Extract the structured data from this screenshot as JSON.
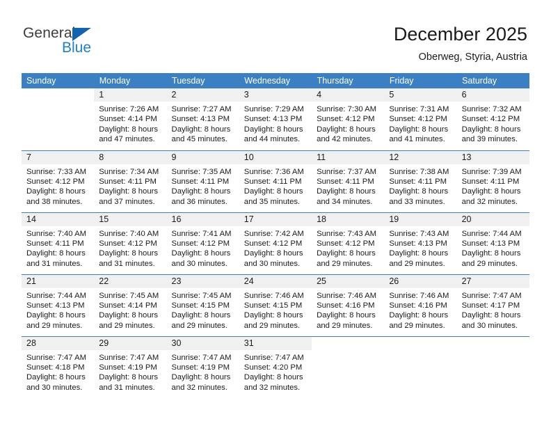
{
  "brand": {
    "name_primary": "General",
    "name_secondary": "Blue",
    "primary_color": "#3d3d3d",
    "secondary_color": "#1b7fd4",
    "triangle_color": "#1263b0"
  },
  "header": {
    "title": "December 2025",
    "subtitle": "Oberweg, Styria, Austria"
  },
  "calendar": {
    "header_bg": "#3b80c4",
    "daynum_bg": "#f0f0f0",
    "weekdays": [
      "Sunday",
      "Monday",
      "Tuesday",
      "Wednesday",
      "Thursday",
      "Friday",
      "Saturday"
    ],
    "weeks": [
      [
        {
          "day": "",
          "sunrise": "",
          "sunset": "",
          "daylight": "",
          "daylight2": ""
        },
        {
          "day": "1",
          "sunrise": "Sunrise: 7:26 AM",
          "sunset": "Sunset: 4:14 PM",
          "daylight": "Daylight: 8 hours",
          "daylight2": "and 47 minutes."
        },
        {
          "day": "2",
          "sunrise": "Sunrise: 7:27 AM",
          "sunset": "Sunset: 4:13 PM",
          "daylight": "Daylight: 8 hours",
          "daylight2": "and 45 minutes."
        },
        {
          "day": "3",
          "sunrise": "Sunrise: 7:29 AM",
          "sunset": "Sunset: 4:13 PM",
          "daylight": "Daylight: 8 hours",
          "daylight2": "and 44 minutes."
        },
        {
          "day": "4",
          "sunrise": "Sunrise: 7:30 AM",
          "sunset": "Sunset: 4:12 PM",
          "daylight": "Daylight: 8 hours",
          "daylight2": "and 42 minutes."
        },
        {
          "day": "5",
          "sunrise": "Sunrise: 7:31 AM",
          "sunset": "Sunset: 4:12 PM",
          "daylight": "Daylight: 8 hours",
          "daylight2": "and 41 minutes."
        },
        {
          "day": "6",
          "sunrise": "Sunrise: 7:32 AM",
          "sunset": "Sunset: 4:12 PM",
          "daylight": "Daylight: 8 hours",
          "daylight2": "and 39 minutes."
        }
      ],
      [
        {
          "day": "7",
          "sunrise": "Sunrise: 7:33 AM",
          "sunset": "Sunset: 4:12 PM",
          "daylight": "Daylight: 8 hours",
          "daylight2": "and 38 minutes."
        },
        {
          "day": "8",
          "sunrise": "Sunrise: 7:34 AM",
          "sunset": "Sunset: 4:11 PM",
          "daylight": "Daylight: 8 hours",
          "daylight2": "and 37 minutes."
        },
        {
          "day": "9",
          "sunrise": "Sunrise: 7:35 AM",
          "sunset": "Sunset: 4:11 PM",
          "daylight": "Daylight: 8 hours",
          "daylight2": "and 36 minutes."
        },
        {
          "day": "10",
          "sunrise": "Sunrise: 7:36 AM",
          "sunset": "Sunset: 4:11 PM",
          "daylight": "Daylight: 8 hours",
          "daylight2": "and 35 minutes."
        },
        {
          "day": "11",
          "sunrise": "Sunrise: 7:37 AM",
          "sunset": "Sunset: 4:11 PM",
          "daylight": "Daylight: 8 hours",
          "daylight2": "and 34 minutes."
        },
        {
          "day": "12",
          "sunrise": "Sunrise: 7:38 AM",
          "sunset": "Sunset: 4:11 PM",
          "daylight": "Daylight: 8 hours",
          "daylight2": "and 33 minutes."
        },
        {
          "day": "13",
          "sunrise": "Sunrise: 7:39 AM",
          "sunset": "Sunset: 4:11 PM",
          "daylight": "Daylight: 8 hours",
          "daylight2": "and 32 minutes."
        }
      ],
      [
        {
          "day": "14",
          "sunrise": "Sunrise: 7:40 AM",
          "sunset": "Sunset: 4:11 PM",
          "daylight": "Daylight: 8 hours",
          "daylight2": "and 31 minutes."
        },
        {
          "day": "15",
          "sunrise": "Sunrise: 7:40 AM",
          "sunset": "Sunset: 4:12 PM",
          "daylight": "Daylight: 8 hours",
          "daylight2": "and 31 minutes."
        },
        {
          "day": "16",
          "sunrise": "Sunrise: 7:41 AM",
          "sunset": "Sunset: 4:12 PM",
          "daylight": "Daylight: 8 hours",
          "daylight2": "and 30 minutes."
        },
        {
          "day": "17",
          "sunrise": "Sunrise: 7:42 AM",
          "sunset": "Sunset: 4:12 PM",
          "daylight": "Daylight: 8 hours",
          "daylight2": "and 30 minutes."
        },
        {
          "day": "18",
          "sunrise": "Sunrise: 7:43 AM",
          "sunset": "Sunset: 4:12 PM",
          "daylight": "Daylight: 8 hours",
          "daylight2": "and 29 minutes."
        },
        {
          "day": "19",
          "sunrise": "Sunrise: 7:43 AM",
          "sunset": "Sunset: 4:13 PM",
          "daylight": "Daylight: 8 hours",
          "daylight2": "and 29 minutes."
        },
        {
          "day": "20",
          "sunrise": "Sunrise: 7:44 AM",
          "sunset": "Sunset: 4:13 PM",
          "daylight": "Daylight: 8 hours",
          "daylight2": "and 29 minutes."
        }
      ],
      [
        {
          "day": "21",
          "sunrise": "Sunrise: 7:44 AM",
          "sunset": "Sunset: 4:13 PM",
          "daylight": "Daylight: 8 hours",
          "daylight2": "and 29 minutes."
        },
        {
          "day": "22",
          "sunrise": "Sunrise: 7:45 AM",
          "sunset": "Sunset: 4:14 PM",
          "daylight": "Daylight: 8 hours",
          "daylight2": "and 29 minutes."
        },
        {
          "day": "23",
          "sunrise": "Sunrise: 7:45 AM",
          "sunset": "Sunset: 4:15 PM",
          "daylight": "Daylight: 8 hours",
          "daylight2": "and 29 minutes."
        },
        {
          "day": "24",
          "sunrise": "Sunrise: 7:46 AM",
          "sunset": "Sunset: 4:15 PM",
          "daylight": "Daylight: 8 hours",
          "daylight2": "and 29 minutes."
        },
        {
          "day": "25",
          "sunrise": "Sunrise: 7:46 AM",
          "sunset": "Sunset: 4:16 PM",
          "daylight": "Daylight: 8 hours",
          "daylight2": "and 29 minutes."
        },
        {
          "day": "26",
          "sunrise": "Sunrise: 7:46 AM",
          "sunset": "Sunset: 4:16 PM",
          "daylight": "Daylight: 8 hours",
          "daylight2": "and 29 minutes."
        },
        {
          "day": "27",
          "sunrise": "Sunrise: 7:47 AM",
          "sunset": "Sunset: 4:17 PM",
          "daylight": "Daylight: 8 hours",
          "daylight2": "and 30 minutes."
        }
      ],
      [
        {
          "day": "28",
          "sunrise": "Sunrise: 7:47 AM",
          "sunset": "Sunset: 4:18 PM",
          "daylight": "Daylight: 8 hours",
          "daylight2": "and 30 minutes."
        },
        {
          "day": "29",
          "sunrise": "Sunrise: 7:47 AM",
          "sunset": "Sunset: 4:19 PM",
          "daylight": "Daylight: 8 hours",
          "daylight2": "and 31 minutes."
        },
        {
          "day": "30",
          "sunrise": "Sunrise: 7:47 AM",
          "sunset": "Sunset: 4:19 PM",
          "daylight": "Daylight: 8 hours",
          "daylight2": "and 32 minutes."
        },
        {
          "day": "31",
          "sunrise": "Sunrise: 7:47 AM",
          "sunset": "Sunset: 4:20 PM",
          "daylight": "Daylight: 8 hours",
          "daylight2": "and 32 minutes."
        },
        {
          "day": "",
          "sunrise": "",
          "sunset": "",
          "daylight": "",
          "daylight2": ""
        },
        {
          "day": "",
          "sunrise": "",
          "sunset": "",
          "daylight": "",
          "daylight2": ""
        },
        {
          "day": "",
          "sunrise": "",
          "sunset": "",
          "daylight": "",
          "daylight2": ""
        }
      ]
    ]
  }
}
